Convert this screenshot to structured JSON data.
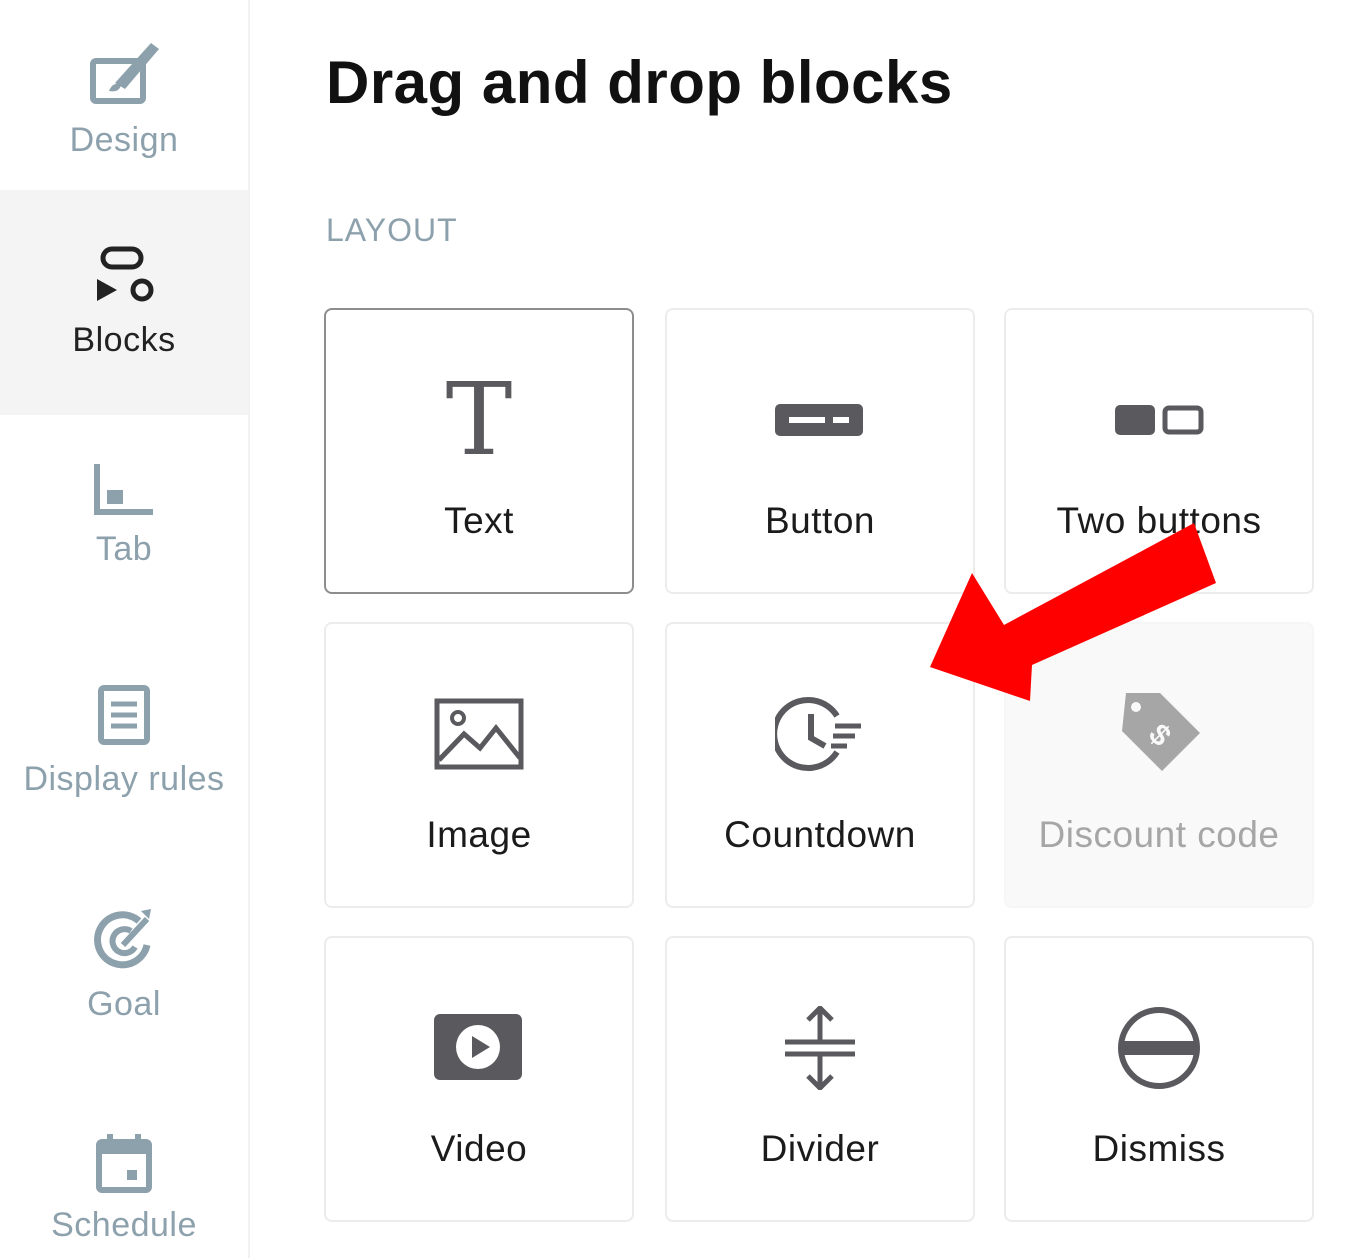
{
  "sidebar": {
    "items": [
      {
        "label": "Design",
        "icon": "design-icon"
      },
      {
        "label": "Blocks",
        "icon": "blocks-icon",
        "active": true
      },
      {
        "label": "Tab",
        "icon": "tab-icon"
      },
      {
        "label": "Display rules",
        "icon": "display-rules-icon"
      },
      {
        "label": "Goal",
        "icon": "goal-icon"
      },
      {
        "label": "Schedule",
        "icon": "schedule-icon"
      }
    ]
  },
  "main": {
    "title": "Drag and drop blocks",
    "section_label": "LAYOUT",
    "blocks": [
      {
        "label": "Text",
        "icon": "text-icon",
        "state": "selected"
      },
      {
        "label": "Button",
        "icon": "button-icon"
      },
      {
        "label": "Two buttons",
        "icon": "two-buttons-icon"
      },
      {
        "label": "Image",
        "icon": "image-icon"
      },
      {
        "label": "Countdown",
        "icon": "countdown-icon"
      },
      {
        "label": "Discount code",
        "icon": "discount-tag-icon",
        "state": "disabled"
      },
      {
        "label": "Video",
        "icon": "video-icon"
      },
      {
        "label": "Divider",
        "icon": "divider-icon"
      },
      {
        "label": "Dismiss",
        "icon": "dismiss-icon"
      }
    ]
  },
  "annotation": {
    "icon": "red-arrow-icon",
    "color": "#ff0000",
    "points_to": "Countdown"
  },
  "colors": {
    "muted": "#8da1ad",
    "icon": "#5a5a5e",
    "active_bg": "#f4f4f5",
    "disabled": "#a6a6a6"
  }
}
